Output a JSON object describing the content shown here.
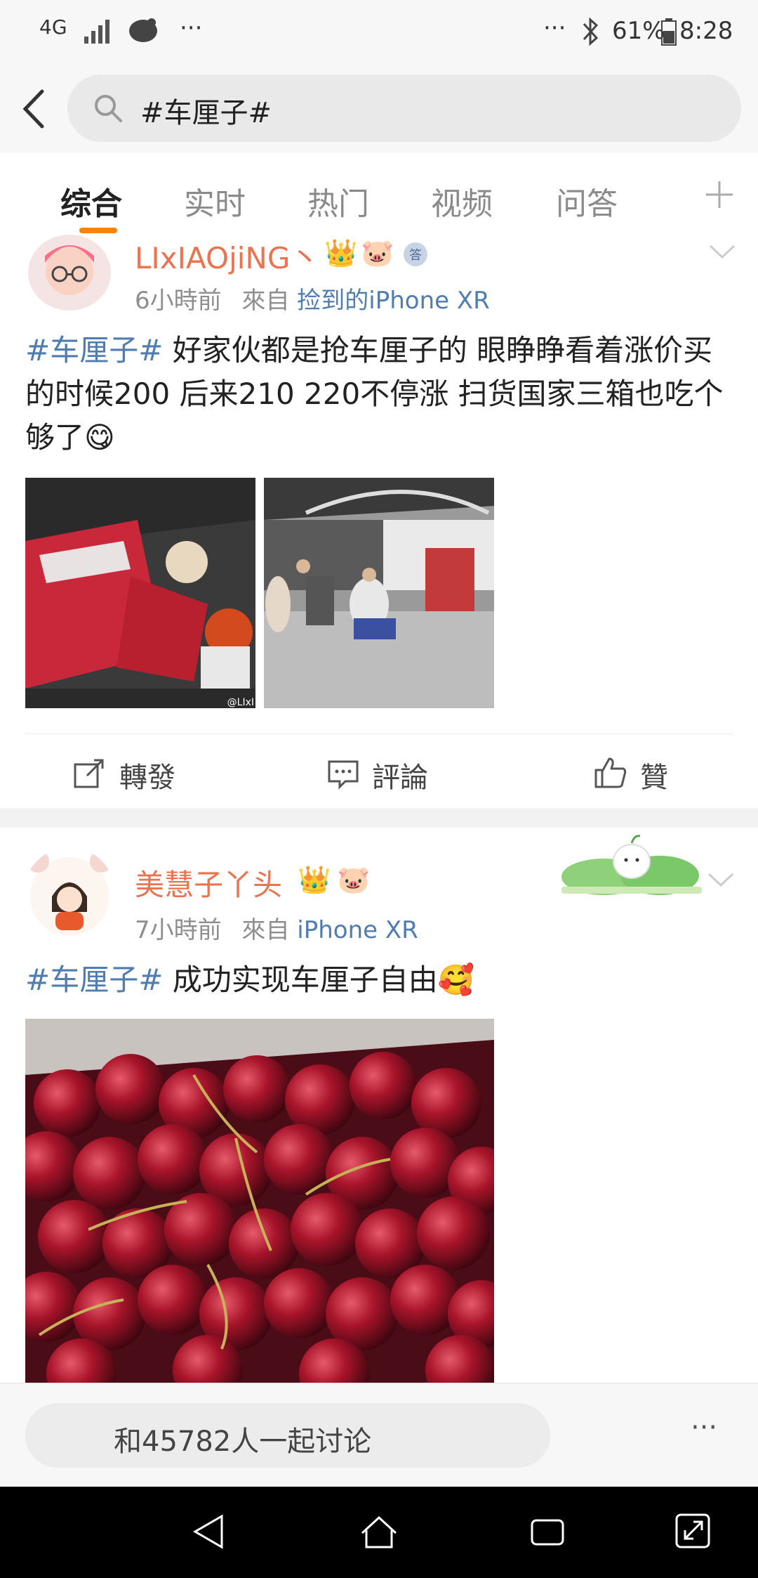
{
  "status_bar": {
    "network": "4G",
    "battery": "61%",
    "time": "8:28"
  },
  "search": {
    "query": "#车厘子#"
  },
  "tabs": [
    {
      "label": "综合",
      "active": true
    },
    {
      "label": "实时",
      "active": false
    },
    {
      "label": "热门",
      "active": false
    },
    {
      "label": "视频",
      "active": false
    },
    {
      "label": "问答",
      "active": false
    }
  ],
  "posts": [
    {
      "username": "LIxIAOjiNG丶",
      "time": "6小時前",
      "from_label": "來自",
      "source": "捡到的iPhone XR",
      "topic": "#车厘子#",
      "text": " 好家伙都是抢车厘子的 眼睁睁看着涨价买的时候200 后来210 220不停涨 扫货国家三箱也吃个够了",
      "emoji": "😋",
      "images": [
        "car trunk with boxes",
        "fruit market"
      ],
      "watermark": "@LIxI",
      "actions": {
        "repost": "轉發",
        "comment": "評論",
        "like": "贊"
      }
    },
    {
      "username": "美慧子丫头",
      "time": "7小時前",
      "from_label": "來自",
      "source": "iPhone XR",
      "topic": "#车厘子#",
      "text": " 成功实现车厘子自由",
      "emoji": "🥰",
      "images": [
        "cherries"
      ]
    }
  ],
  "bottom_bar": {
    "discuss_placeholder": "和45782人一起讨论",
    "more": "···"
  },
  "colors": {
    "accent": "#ff8200",
    "username": "#eb7350",
    "link": "#507daf"
  }
}
